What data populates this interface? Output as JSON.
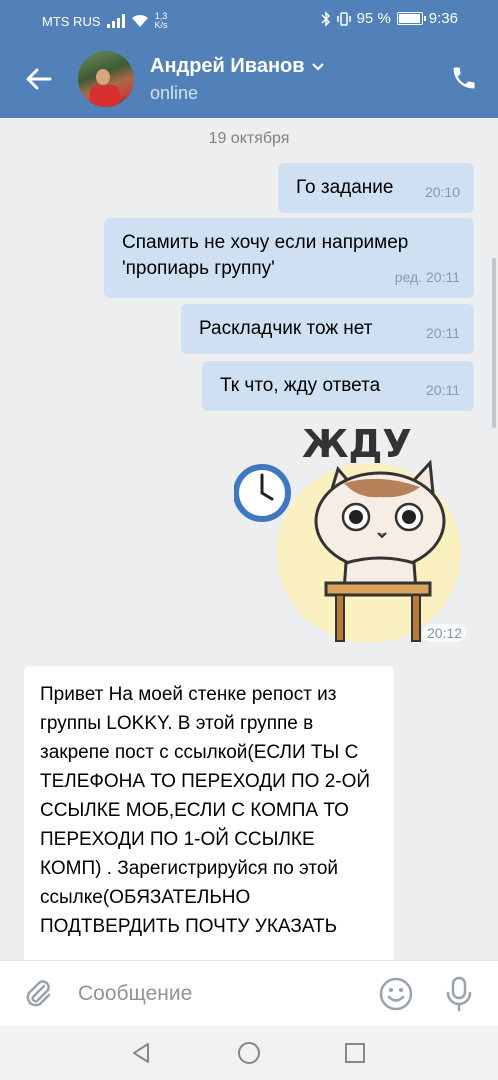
{
  "status_bar": {
    "carrier": "MTS RUS",
    "speed_value": "1,3",
    "speed_unit": "K/s",
    "battery": "95 %",
    "time": "9:36"
  },
  "header": {
    "name": "Андрей Иванов",
    "status": "online"
  },
  "chat": {
    "date": "19 октября",
    "messages": [
      {
        "direction": "out",
        "text": "Го задание",
        "time": "20:10"
      },
      {
        "direction": "out",
        "text": "Спамить не хочу если например 'пропиарь группу'",
        "time": "ред. 20:11"
      },
      {
        "direction": "out",
        "text": "Раскладчик тож нет",
        "time": "20:11"
      },
      {
        "direction": "out",
        "text": "Тк что, жду ответа",
        "time": "20:11"
      },
      {
        "direction": "out",
        "type": "sticker",
        "sticker_text": "ЖДУ",
        "time": "20:12"
      },
      {
        "direction": "in",
        "text": "Привет На моей стенке репост из группы LOKKY. В этой группе в закрепе пост с ссылкой(ЕСЛИ ТЫ С ТЕЛЕФОНА ТО ПЕРЕХОДИ ПО 2-ОЙ ССЫЛКЕ МОБ,ЕСЛИ С КОМПА ТО ПЕРЕХОДИ ПО 1-ОЙ ССЫЛКЕ КОМП) . Зарегистрируйся по этой ссылке(ОБЯЗАТЕЛЬНО ПОДТВЕРДИТЬ ПОЧТУ УКАЗАТЬ"
      }
    ]
  },
  "input": {
    "placeholder": "Сообщение"
  },
  "colors": {
    "brand": "#5181b8",
    "outgoing_bubble": "#cfe0f2",
    "incoming_bubble": "#ffffff",
    "chat_background": "#edeef0"
  },
  "icons": [
    "signal-icon",
    "wifi-icon",
    "bluetooth-icon",
    "vibrate-icon",
    "battery-icon",
    "back-arrow-icon",
    "chevron-down-icon",
    "phone-icon",
    "paperclip-icon",
    "smiley-icon",
    "microphone-icon",
    "nav-back-icon",
    "nav-home-icon",
    "nav-recent-icon"
  ]
}
